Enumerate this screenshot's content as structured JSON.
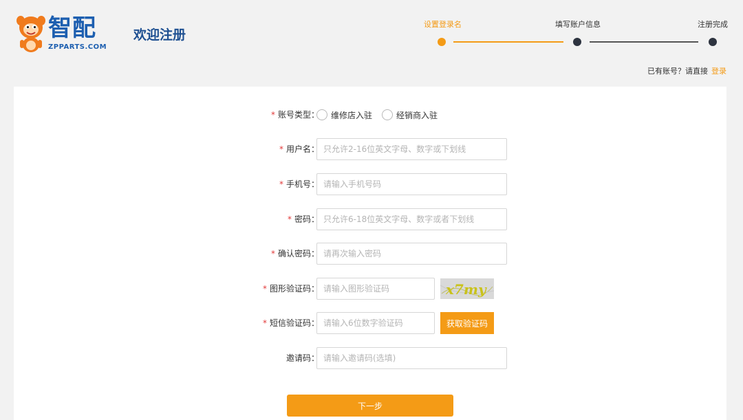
{
  "brand": {
    "name": "智配",
    "domain": "ZPPARTS.COM",
    "primary_color": "#1d5fb0",
    "accent_color": "#f49b16"
  },
  "header": {
    "title": "欢迎注册",
    "login_hint": "已有账号？请直接",
    "login_link": "登录"
  },
  "steps": [
    {
      "label": "设置登录名",
      "active": true
    },
    {
      "label": "填写账户信息",
      "active": false
    },
    {
      "label": "注册完成",
      "active": false
    }
  ],
  "form": {
    "account_type": {
      "label": "账号类型：",
      "options": [
        "维修店入驻",
        "经销商入驻"
      ]
    },
    "username": {
      "label": "用户名：",
      "placeholder": "只允许2-16位英文字母、数字或下划线",
      "value": ""
    },
    "phone": {
      "label": "手机号：",
      "placeholder": "请输入手机号码",
      "value": ""
    },
    "password": {
      "label": "密码：",
      "placeholder": "只允许6-18位英文字母、数字或者下划线",
      "value": ""
    },
    "confirm_password": {
      "label": "确认密码：",
      "placeholder": "请再次输入密码",
      "value": ""
    },
    "image_captcha": {
      "label": "图形验证码：",
      "placeholder": "请输入图形验证码",
      "value": "",
      "captcha_text": "x7my"
    },
    "sms_code": {
      "label": "短信验证码：",
      "placeholder": "请输入6位数字验证码",
      "value": "",
      "button_label": "获取验证码"
    },
    "invite_code": {
      "label": "邀请码：",
      "placeholder": "请输入邀请码(选填)",
      "value": ""
    },
    "required_mark": "*",
    "next_label": "下一步"
  }
}
